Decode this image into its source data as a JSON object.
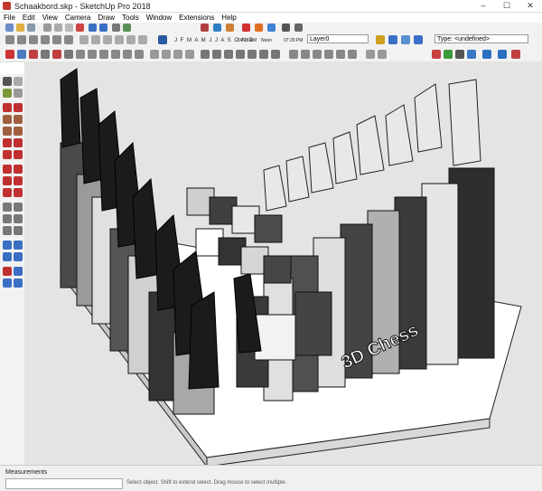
{
  "window": {
    "title": "Schaakbord.skp - SketchUp Pro 2018",
    "controls": [
      "–",
      "☐",
      "✕"
    ]
  },
  "menu": [
    "File",
    "Edit",
    "View",
    "Camera",
    "Draw",
    "Tools",
    "Window",
    "Extensions",
    "Help"
  ],
  "shadow": {
    "months": "J F M A M J J A S O N D",
    "time_start": "04:38 AM",
    "time_noon": "Noon",
    "time_end": "07:29 PM"
  },
  "layer": {
    "value": "Layer0"
  },
  "entity_type": {
    "value": "Type: <undefined>"
  },
  "model": {
    "engraving": "3D Chess"
  },
  "status": {
    "measurements_label": "Measurements",
    "hint": "Select object. Shift to extend select. Drag mouse to select multiple."
  },
  "colors": {
    "background": "#e4e4e2",
    "board": "#ffffff",
    "dark_piece": "#1b1b1b",
    "light_piece": "#e8e8e8"
  }
}
